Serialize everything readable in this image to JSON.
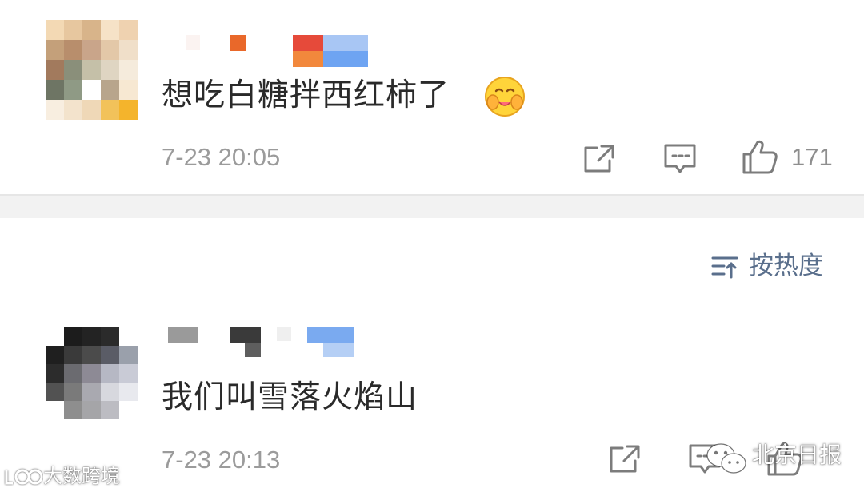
{
  "comments": [
    {
      "text": "想吃白糖拌西红柿了",
      "emoji": "hug-emoji",
      "time": "7-23 20:05",
      "likes": "171",
      "avatar_colors": [
        "#f3d9b4",
        "#e7c79f",
        "#d8b48a",
        "#f6e2c7",
        "#efd2b0",
        "#c4a07a",
        "#b88e6c",
        "#c9a58a",
        "#e3c8a8",
        "#f0dfc9",
        "#a27a5d",
        "#8a8f7a",
        "#c5c0a8",
        "#dfd5c2",
        "#f5ebdc",
        "#6e7564",
        "#8f9a85",
        "#ffffff",
        "#b8a58c",
        "#f7e8d2",
        "#f8eee0",
        "#f3e3cc",
        "#efd8b7",
        "#f2c25a",
        "#f4b42c"
      ]
    },
    {
      "text": "我们叫雪落火焰山",
      "time": "7-23 20:13",
      "avatar_colors": [
        "#ffffff",
        "#1c1c1c",
        "#232323",
        "#2b2b2b",
        "#ffffff",
        "#1f1f1f",
        "#3a3a3a",
        "#4b4b4b",
        "#5a5c66",
        "#9aa0ab",
        "#2c2c2c",
        "#6b6b70",
        "#8d8a95",
        "#b6b8c4",
        "#c9cbd6",
        "#525252",
        "#7a7a7a",
        "#a9a9b0",
        "#d7d8de",
        "#e8e9ee",
        "#ffffff",
        "#8e8e8e",
        "#a5a5a8",
        "#bcbcc2",
        "#ffffff"
      ]
    }
  ],
  "sort": {
    "label": "按热度"
  },
  "watermarks": {
    "left": "大数跨境",
    "right": "北京日报"
  },
  "icons": {
    "share": "share-icon",
    "reply": "comment-icon",
    "like": "thumbs-up-icon",
    "sort": "sort-icon"
  }
}
